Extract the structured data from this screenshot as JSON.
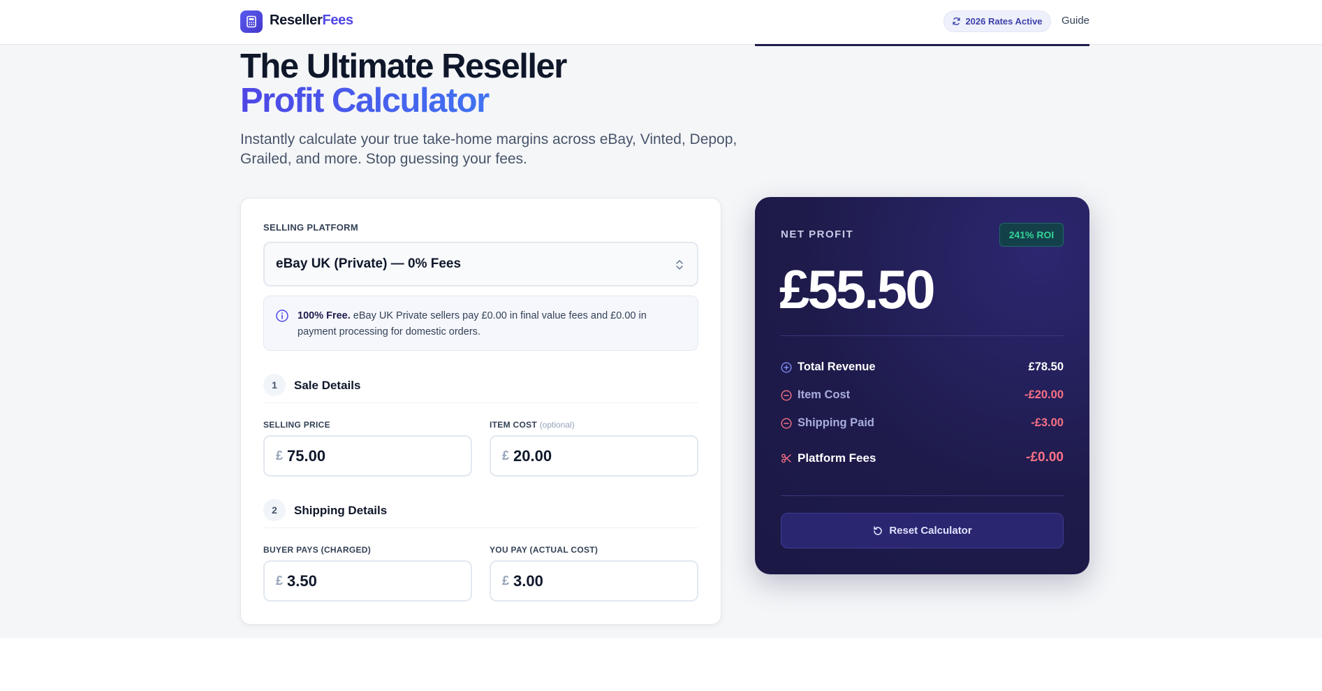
{
  "header": {
    "logo_part1": "Reseller",
    "logo_part2": "Fees",
    "rates_badge": "2026 Rates Active",
    "guide_link": "Guide"
  },
  "hero": {
    "title_line1": "The Ultimate Reseller",
    "title_line2": "Profit Calculator",
    "subtitle": "Instantly calculate your true take-home margins across eBay, Vinted, Depop, Grailed, and more. Stop guessing your fees."
  },
  "calculator": {
    "platform_label": "SELLING PLATFORM",
    "platform_value": "eBay UK (Private) — 0% Fees",
    "info_strong": "100% Free.",
    "info_text": " eBay UK Private sellers pay £0.00 in final value fees and £0.00 in payment processing for domestic orders.",
    "step1": {
      "number": "1",
      "title": "Sale Details"
    },
    "selling_price": {
      "label": "SELLING PRICE",
      "currency": "£",
      "value": "75.00"
    },
    "item_cost": {
      "label": "ITEM COST",
      "optional": "(optional)",
      "currency": "£",
      "value": "20.00"
    },
    "step2": {
      "number": "2",
      "title": "Shipping Details"
    },
    "buyer_pays": {
      "label": "BUYER PAYS (CHARGED)",
      "currency": "£",
      "value": "3.50"
    },
    "you_pay": {
      "label": "YOU PAY (ACTUAL COST)",
      "currency": "£",
      "value": "3.00"
    }
  },
  "results": {
    "net_profit_label": "NET PROFIT",
    "roi_badge": "241% ROI",
    "net_profit_value": "£55.50",
    "rows": [
      {
        "name": "Total Revenue",
        "amount": "£78.50"
      },
      {
        "name": "Item Cost",
        "amount": "-£20.00"
      },
      {
        "name": "Shipping Paid",
        "amount": "-£3.00"
      },
      {
        "name": "Platform Fees",
        "amount": "-£0.00"
      }
    ],
    "reset_label": "Reset Calculator"
  },
  "colors": {
    "brand": "#4f46e5",
    "card_dark": "#1e1b4b",
    "positive": "#34d399",
    "negative": "#fb7185"
  }
}
